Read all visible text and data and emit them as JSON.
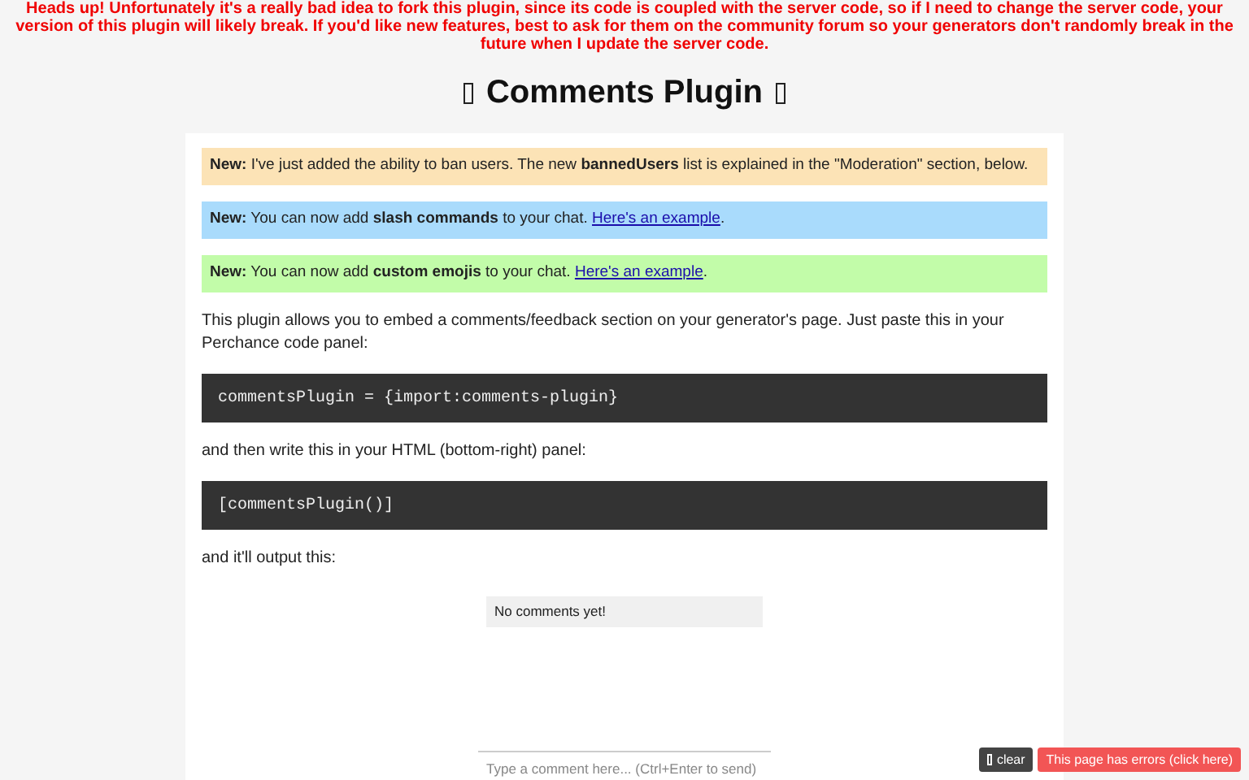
{
  "warning": "Heads up! Unfortunately it's a really bad idea to fork this plugin, since its code is coupled with the server code, so if I need to change the server code, your version of this plugin will likely break. If you'd like new features, best to ask for them on the community forum so your generators don't randomly break in the future when I update the server code.",
  "title": "Comments Plugin",
  "notices": [
    {
      "color": "#fce3b6",
      "text": "**New:** I've just added the ability to ban users. The new **bannedUsers** list is explained in the \"Moderation\" section, below."
    },
    {
      "color": "#a9dbfc",
      "text": "**New:** You can now add **slash commands** to your chat. ",
      "link": "Here's an example",
      "after": "."
    },
    {
      "color": "#c2fca9",
      "text": "**New:** You can now add **custom emojis** to your chat. ",
      "link": "Here's an example",
      "after": "."
    }
  ],
  "blocks": [
    {
      "kind": "text",
      "text": "This plugin allows you to embed a comments/feedback section on your generator's page. Just paste this in your Perchance code panel:"
    },
    {
      "kind": "code",
      "text": "commentsPlugin = {import:comments-plugin}"
    },
    {
      "kind": "text",
      "text": "and then write this in your HTML (bottom-right) panel:"
    },
    {
      "kind": "code",
      "text": "[commentsPlugin()]"
    },
    {
      "kind": "text",
      "text": "and it'll output this:"
    }
  ],
  "comments": {
    "empty_message": "No comments yet!",
    "placeholder": "Type a comment here... (Ctrl+Enter to send)"
  },
  "console": {
    "clear": "clear",
    "errors": "This page has errors (click here)"
  }
}
